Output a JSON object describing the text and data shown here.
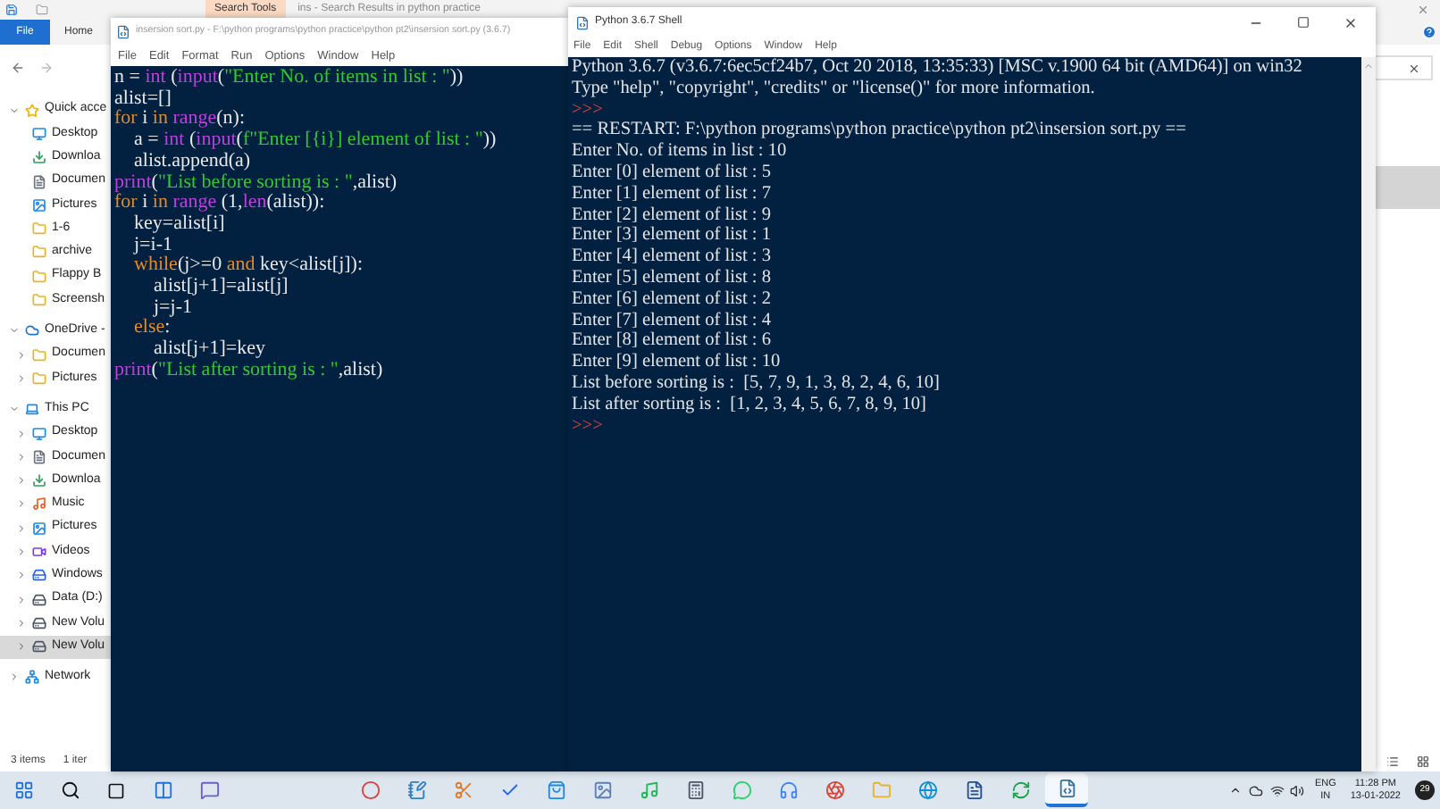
{
  "explorer": {
    "ribbon_tab": "Search Tools",
    "title": "ins - Search Results in python practice",
    "file_tab": "File",
    "home_tab": "Home",
    "sidebar": [
      {
        "label": "Quick acce",
        "kind": "star",
        "expanded": true,
        "children": [
          {
            "label": "Desktop",
            "kind": "desktop"
          },
          {
            "label": "Downloa",
            "kind": "download"
          },
          {
            "label": "Documen",
            "kind": "document"
          },
          {
            "label": "Pictures",
            "kind": "picture"
          },
          {
            "label": "1-6",
            "kind": "folder"
          },
          {
            "label": "archive",
            "kind": "folder"
          },
          {
            "label": "Flappy B",
            "kind": "folder"
          },
          {
            "label": "Screensh",
            "kind": "folder"
          }
        ]
      },
      {
        "label": "OneDrive -",
        "kind": "cloud",
        "expanded": true,
        "children": [
          {
            "label": "Documen",
            "kind": "folder",
            "expanded": false,
            "selected": false
          },
          {
            "label": "Pictures",
            "kind": "folder",
            "expanded": false,
            "selected": false
          }
        ]
      },
      {
        "label": "This PC",
        "kind": "pc",
        "expanded": true,
        "children": [
          {
            "label": "Desktop",
            "kind": "desktop",
            "expanded": false,
            "selected": false
          },
          {
            "label": "Documen",
            "kind": "document",
            "expanded": false,
            "selected": false
          },
          {
            "label": "Downloa",
            "kind": "download",
            "expanded": false,
            "selected": false
          },
          {
            "label": "Music",
            "kind": "music",
            "expanded": false,
            "selected": false
          },
          {
            "label": "Pictures",
            "kind": "picture",
            "expanded": false,
            "selected": false
          },
          {
            "label": "Videos",
            "kind": "video",
            "expanded": false,
            "selected": false
          },
          {
            "label": "Windows",
            "kind": "windrive",
            "expanded": false,
            "selected": false
          },
          {
            "label": "Data (D:)",
            "kind": "drive",
            "expanded": false,
            "selected": false
          },
          {
            "label": "New Volu",
            "kind": "drive",
            "expanded": false,
            "selected": false
          },
          {
            "label": "New Volu",
            "kind": "drive",
            "expanded": false,
            "selected": true
          }
        ]
      },
      {
        "label": "Network",
        "kind": "network",
        "expanded": false
      }
    ],
    "status": [
      "3 items",
      "1 iter"
    ]
  },
  "editor": {
    "title": "insersion sort.py - F:\\python programs\\python practice\\python pt2\\insersion sort.py (3.6.7)",
    "menu": [
      "File",
      "Edit",
      "Format",
      "Run",
      "Options",
      "Window",
      "Help"
    ],
    "lines": [
      [
        {
          "text": "n = ",
          "kind": "plain"
        },
        {
          "text": "int",
          "kind": "builtin"
        },
        {
          "text": " (",
          "kind": "plain"
        },
        {
          "text": "input",
          "kind": "builtin"
        },
        {
          "text": "(",
          "kind": "plain"
        },
        {
          "text": "\"Enter No. of items in list : \"",
          "kind": "string"
        },
        {
          "text": "))",
          "kind": "plain"
        }
      ],
      [
        {
          "text": "alist=[]",
          "kind": "plain"
        }
      ],
      [
        {
          "text": "for",
          "kind": "keyword"
        },
        {
          "text": " i ",
          "kind": "plain"
        },
        {
          "text": "in",
          "kind": "keyword"
        },
        {
          "text": " range",
          "kind": "builtin"
        },
        {
          "text": "(n):",
          "kind": "plain"
        }
      ],
      [
        {
          "text": "    a = ",
          "kind": "plain"
        },
        {
          "text": "int",
          "kind": "builtin"
        },
        {
          "text": " (",
          "kind": "plain"
        },
        {
          "text": "input",
          "kind": "builtin"
        },
        {
          "text": "(",
          "kind": "plain"
        },
        {
          "text": "f\"Enter [{i}] element of list : \"",
          "kind": "string"
        },
        {
          "text": "))",
          "kind": "plain"
        }
      ],
      [
        {
          "text": "    alist.append(a)",
          "kind": "plain"
        }
      ],
      [
        {
          "text": "print",
          "kind": "builtin"
        },
        {
          "text": "(",
          "kind": "plain"
        },
        {
          "text": "\"List before sorting is : \"",
          "kind": "string"
        },
        {
          "text": ",alist)",
          "kind": "plain"
        }
      ],
      [
        {
          "text": "for",
          "kind": "keyword"
        },
        {
          "text": " i ",
          "kind": "plain"
        },
        {
          "text": "in",
          "kind": "keyword"
        },
        {
          "text": " range",
          "kind": "builtin"
        },
        {
          "text": " (1,",
          "kind": "plain"
        },
        {
          "text": "len",
          "kind": "builtin"
        },
        {
          "text": "(alist)):",
          "kind": "plain"
        }
      ],
      [
        {
          "text": "    key=alist[i]",
          "kind": "plain"
        }
      ],
      [
        {
          "text": "    j=i-1",
          "kind": "plain"
        }
      ],
      [
        {
          "text": "    while",
          "kind": "keyword"
        },
        {
          "text": "(j>=0 ",
          "kind": "plain"
        },
        {
          "text": "and",
          "kind": "keyword"
        },
        {
          "text": " key<alist[j]):",
          "kind": "plain"
        }
      ],
      [
        {
          "text": "        alist[j+1]=alist[j]",
          "kind": "plain"
        }
      ],
      [
        {
          "text": "        j=j-1",
          "kind": "plain"
        }
      ],
      [
        {
          "text": "    else",
          "kind": "keyword"
        },
        {
          "text": ":",
          "kind": "plain"
        }
      ],
      [
        {
          "text": "        alist[j+1]=key",
          "kind": "plain"
        }
      ],
      [
        {
          "text": "print",
          "kind": "builtin"
        },
        {
          "text": "(",
          "kind": "plain"
        },
        {
          "text": "\"List after sorting is : \"",
          "kind": "string"
        },
        {
          "text": ",alist)",
          "kind": "plain"
        }
      ]
    ]
  },
  "shell": {
    "title": "Python 3.6.7 Shell",
    "menu": [
      "File",
      "Edit",
      "Shell",
      "Debug",
      "Options",
      "Window",
      "Help"
    ],
    "lines": [
      {
        "text": "Python 3.6.7 (v3.6.7:6ec5cf24b7, Oct 20 2018, 13:35:33) [MSC v.1900 64 bit (AMD64)] on win32",
        "kind": "output"
      },
      {
        "text": "Type \"help\", \"copyright\", \"credits\" or \"license()\" for more information.",
        "kind": "output"
      },
      {
        "text": ">>>",
        "kind": "prompt"
      },
      {
        "text": "== RESTART: F:\\python programs\\python practice\\python pt2\\insersion sort.py ==",
        "kind": "output"
      },
      {
        "text": "Enter No. of items in list : 10",
        "kind": "output"
      },
      {
        "text": "Enter [0] element of list : 5",
        "kind": "output"
      },
      {
        "text": "Enter [1] element of list : 7",
        "kind": "output"
      },
      {
        "text": "Enter [2] element of list : 9",
        "kind": "output"
      },
      {
        "text": "Enter [3] element of list : 1",
        "kind": "output"
      },
      {
        "text": "Enter [4] element of list : 3",
        "kind": "output"
      },
      {
        "text": "Enter [5] element of list : 8",
        "kind": "output"
      },
      {
        "text": "Enter [6] element of list : 2",
        "kind": "output"
      },
      {
        "text": "Enter [7] element of list : 4",
        "kind": "output"
      },
      {
        "text": "Enter [8] element of list : 6",
        "kind": "output"
      },
      {
        "text": "Enter [9] element of list : 10",
        "kind": "output"
      },
      {
        "text": "List before sorting is :  [5, 7, 9, 1, 3, 8, 2, 4, 6, 10]",
        "kind": "output"
      },
      {
        "text": "List after sorting is :  [1, 2, 3, 4, 5, 6, 7, 8, 9, 10]",
        "kind": "output"
      },
      {
        "text": ">>>",
        "kind": "prompt"
      }
    ]
  },
  "taskbar": {
    "apps": [
      {
        "selected": false
      },
      {
        "selected": false
      },
      {
        "selected": false
      },
      {
        "selected": false
      },
      {
        "selected": false
      },
      {
        "selected": false
      },
      {
        "selected": false
      },
      {
        "selected": false
      },
      {
        "selected": false
      },
      {
        "selected": false
      },
      {
        "selected": false
      },
      {
        "selected": false
      },
      {
        "selected": false
      },
      {
        "selected": false
      },
      {
        "selected": false
      },
      {
        "selected": true
      }
    ],
    "language": "ENG",
    "region": "IN",
    "time": "11:28 PM",
    "date": "13-01-2022",
    "notifications": "29"
  }
}
